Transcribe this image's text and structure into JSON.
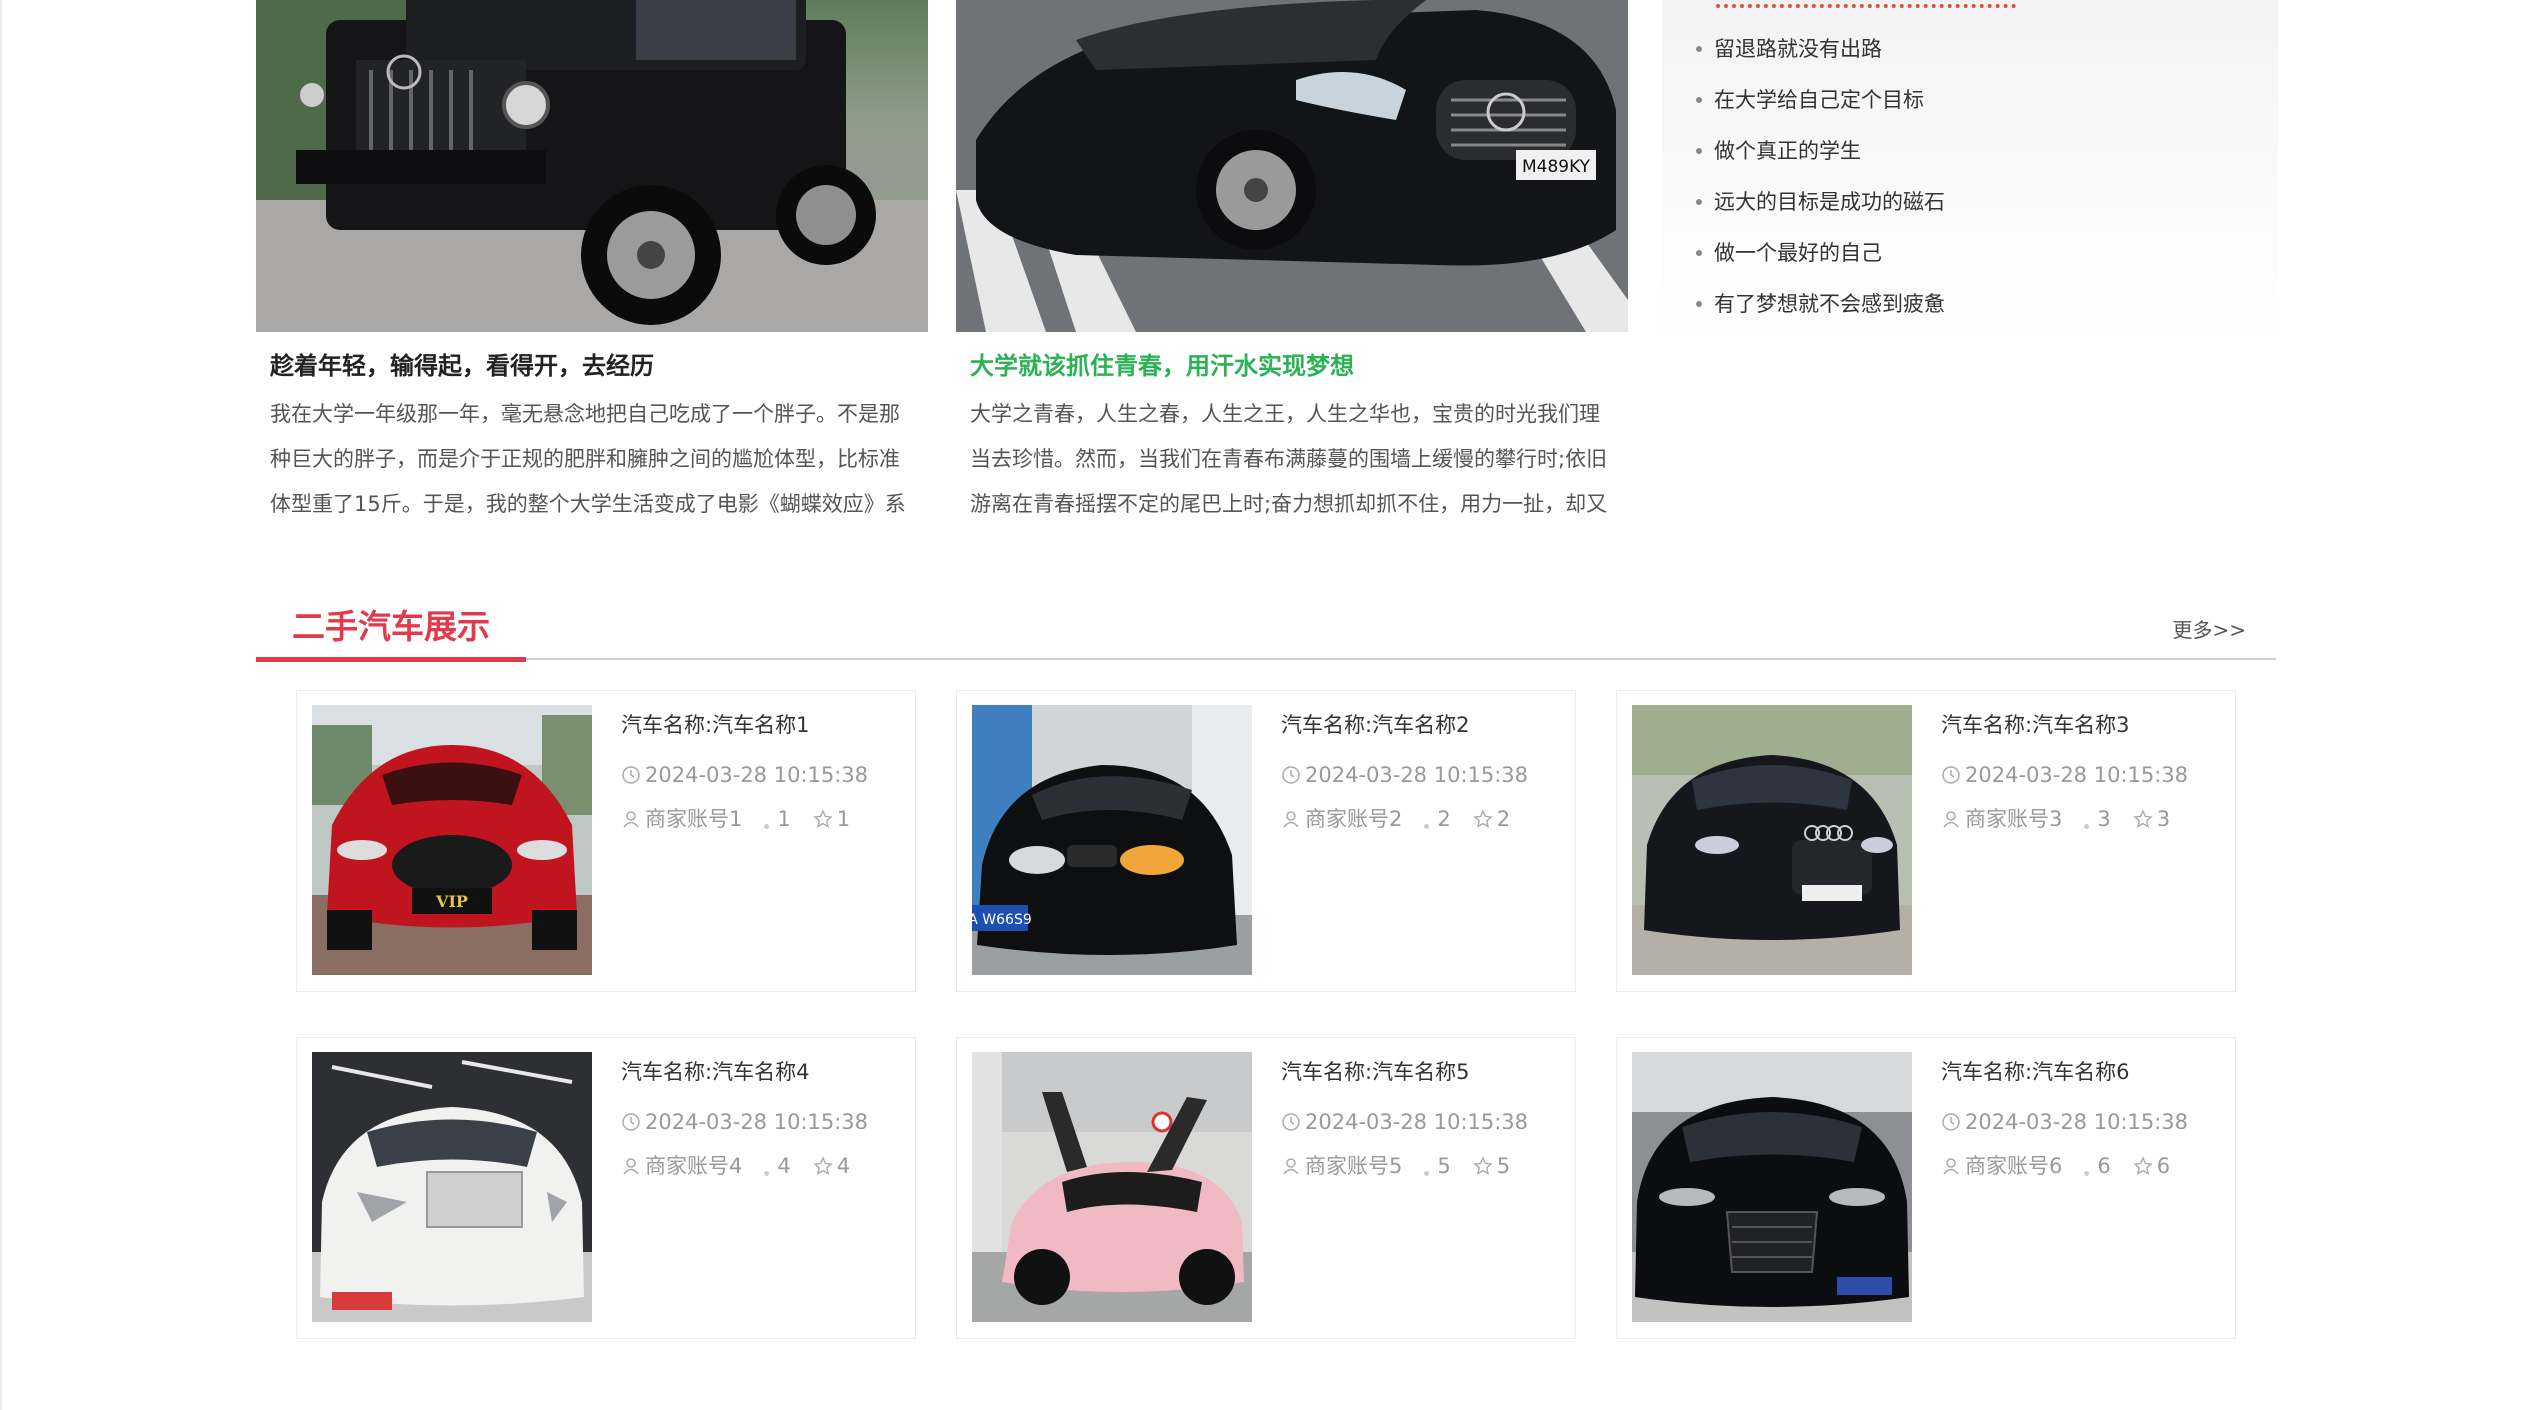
{
  "articles": [
    {
      "title": "趁着年轻，输得起，看得开，去经历",
      "excerpt": "我在大学一年级那一年，毫无悬念地把自己吃成了一个胖子。不是那种巨大的胖子，而是介于正规的肥胖和臃肿之间的尴尬体型，比标准体型重了15斤。于是，我的整个大学生活变成了电影《蝴蝶效应》系"
    },
    {
      "title": "大学就该抓住青春，用汗水实现梦想",
      "excerpt": "大学之青春，人生之春，人生之王，人生之华也，宝贵的时光我们理当去珍惜。然而，当我们在青春布满藤蔓的围墙上缓慢的攀行时;依旧游离在青春摇摆不定的尾巴上时;奋力想抓却抓不住，用力一扯，却又"
    }
  ],
  "side_list": [
    "留退路就没有出路",
    "在大学给自己定个目标",
    "做个真正的学生",
    "远大的目标是成功的磁石",
    "做一个最好的自己",
    "有了梦想就不会感到疲惫"
  ],
  "section": {
    "title": "二手汽车展示",
    "more": "更多>>"
  },
  "cars": [
    {
      "name": "汽车名称:汽车名称1",
      "time": "2024-03-28 10:15:38",
      "merchant": "商家账号1",
      "views": "1",
      "stars": "1"
    },
    {
      "name": "汽车名称:汽车名称2",
      "time": "2024-03-28 10:15:38",
      "merchant": "商家账号2",
      "views": "2",
      "stars": "2"
    },
    {
      "name": "汽车名称:汽车名称3",
      "time": "2024-03-28 10:15:38",
      "merchant": "商家账号3",
      "views": "3",
      "stars": "3"
    },
    {
      "name": "汽车名称:汽车名称4",
      "time": "2024-03-28 10:15:38",
      "merchant": "商家账号4",
      "views": "4",
      "stars": "4"
    },
    {
      "name": "汽车名称:汽车名称5",
      "time": "2024-03-28 10:15:38",
      "merchant": "商家账号5",
      "views": "5",
      "stars": "5"
    },
    {
      "name": "汽车名称:汽车名称6",
      "time": "2024-03-28 10:15:38",
      "merchant": "商家账号6",
      "views": "6",
      "stars": "6"
    }
  ],
  "plate_labels": {
    "car1": "VIP",
    "car2": "A W66S9",
    "article2": "M489KY"
  },
  "icons": {
    "time": "clock-icon",
    "merchant": "user-icon",
    "star": "star-icon"
  },
  "colors": {
    "accent": "#e23a4b",
    "green_title": "#2bb256"
  }
}
